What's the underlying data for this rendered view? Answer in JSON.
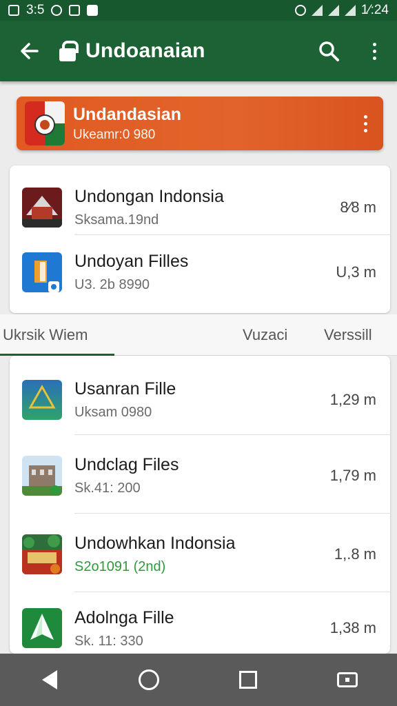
{
  "status_bar": {
    "time_left": "3:5",
    "time_right": "1⁄:24"
  },
  "app_bar": {
    "title": "Undoanaian"
  },
  "banner": {
    "title": "Undandasian",
    "subtitle": "Ukeamr:0 980"
  },
  "top_list": [
    {
      "name": "Undongan Indonsia",
      "meta": "Sksama.19nd",
      "size": "8⁄8  m"
    },
    {
      "name": "Undoyan Filles",
      "meta": "U3. 2b 8990",
      "size": "U,3  m"
    }
  ],
  "tabs": [
    {
      "label": "Ukrsik Wiem"
    },
    {
      "label": "Vuzaci"
    },
    {
      "label": "Verssill"
    }
  ],
  "files": [
    {
      "name": "Usanran Fille",
      "meta": "Uksam 0980",
      "size": "1,29 m",
      "meta_color": "gray"
    },
    {
      "name": "Undclag Files",
      "meta": "Sk.41: 200",
      "size": "1,79 m",
      "meta_color": "gray"
    },
    {
      "name": "Undowhkan Indonsia",
      "meta": "S2o1091 (2nd)",
      "size": "1,.8  m",
      "meta_color": "green"
    },
    {
      "name": "Adolnga Fille",
      "meta": "Sk. 11: 330",
      "size": "1,38 m",
      "meta_color": "gray"
    }
  ],
  "colors": {
    "app_bar": "#1c6235",
    "status_bar": "#17582f",
    "banner": "#e05a22",
    "accent_green": "#2e9a3a",
    "nav_bar": "#5a5a5a"
  }
}
